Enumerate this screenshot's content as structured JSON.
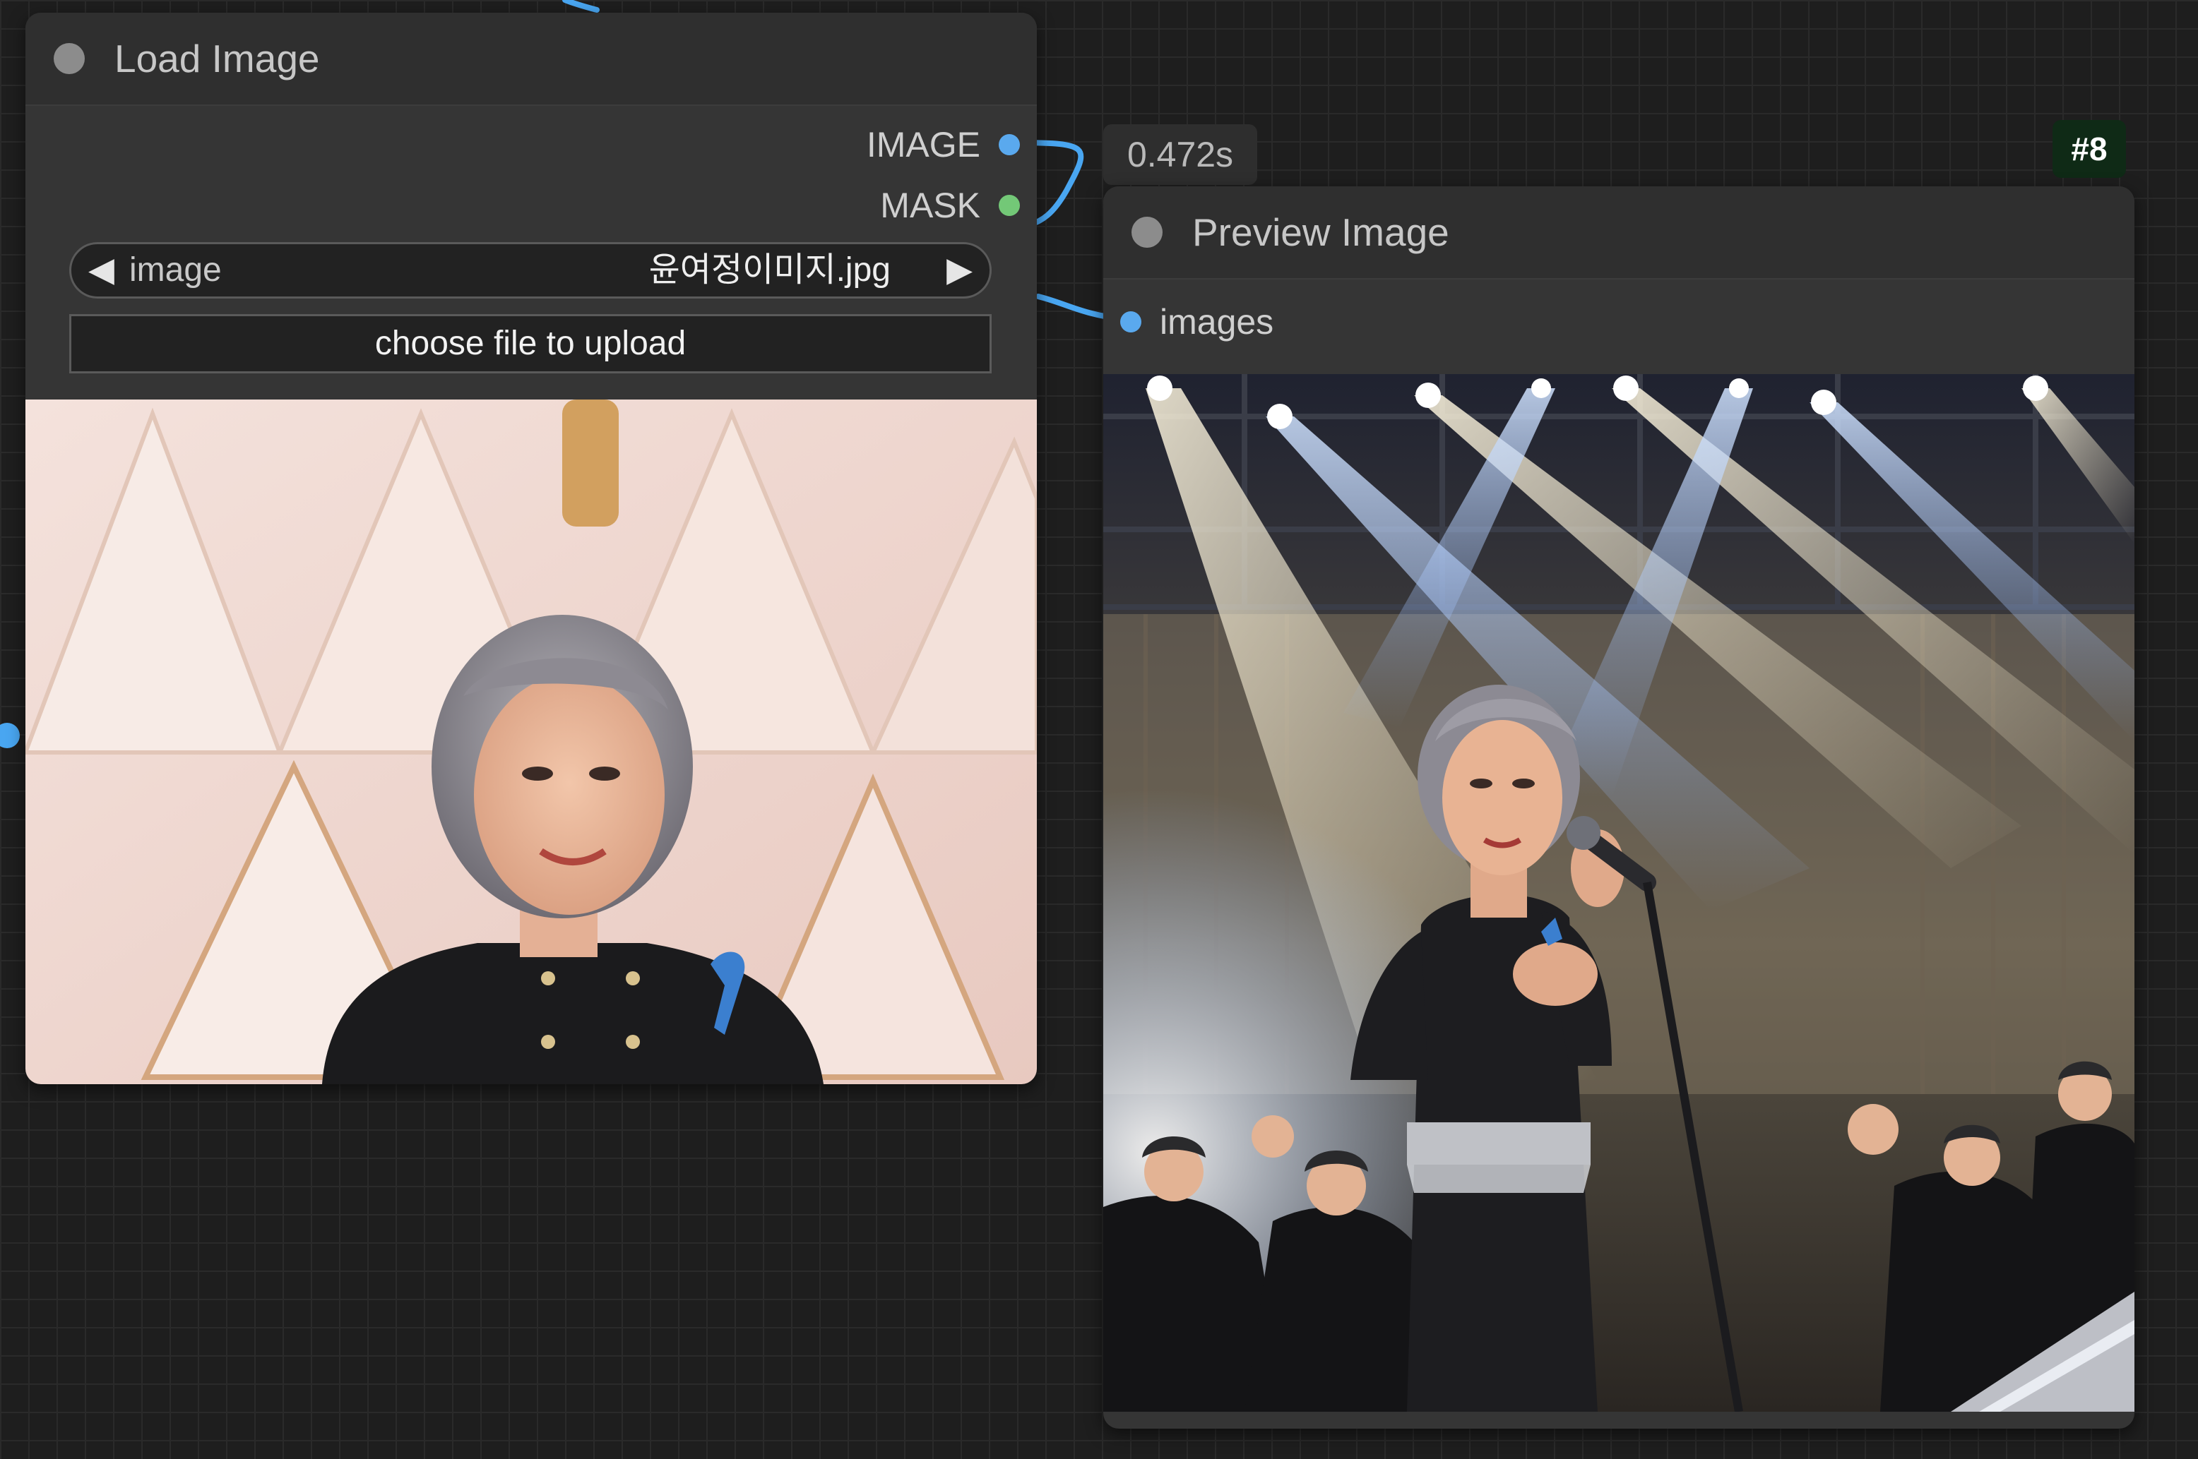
{
  "canvas": {
    "link_color": "#49a6f1",
    "image_slot_color": "#5aa9ee",
    "mask_slot_color": "#73c877",
    "badge_green": "#0f2a16"
  },
  "load_image_node": {
    "title": "Load Image",
    "outputs": [
      {
        "label": "IMAGE",
        "color": "#5aa9ee"
      },
      {
        "label": "MASK",
        "color": "#73c877"
      }
    ],
    "widget": {
      "name": "image",
      "value": "윤여정이미지.jpg",
      "prev_icon": "◀",
      "next_icon": "▶"
    },
    "upload_label": "choose file to upload",
    "preview_icon": "portrait-photo"
  },
  "preview_image_node": {
    "title": "Preview Image",
    "timer": "0.472s",
    "node_id": "#8",
    "inputs": [
      {
        "label": "images",
        "color": "#5aa9ee"
      }
    ],
    "preview_icon": "concert-stage-photo"
  }
}
